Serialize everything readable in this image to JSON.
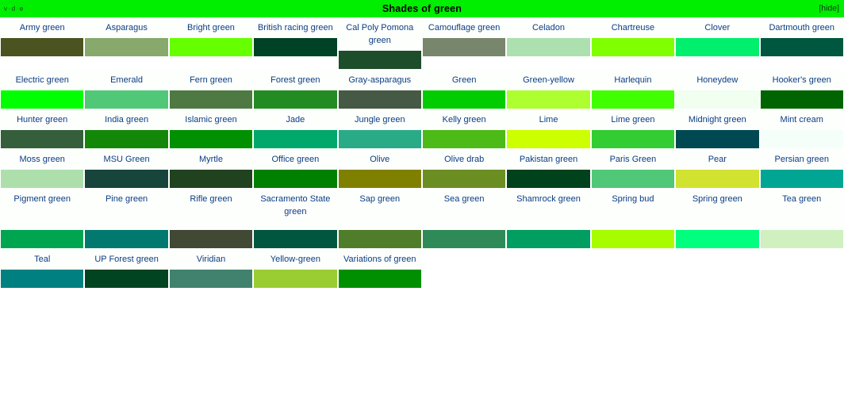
{
  "header": {
    "edit_links": [
      "v",
      "d",
      "e"
    ],
    "separator": "·",
    "title": "Shades of green",
    "hide_label": "[hide]",
    "bar_color": "#00ee00"
  },
  "link_color": "#0b3c82",
  "rows": [
    [
      {
        "name": "Army green",
        "color": "#4b5320"
      },
      {
        "name": "Asparagus",
        "color": "#87a96b"
      },
      {
        "name": "Bright green",
        "color": "#66ff00"
      },
      {
        "name": "British racing green",
        "color": "#004225"
      },
      {
        "name": "Cal Poly Pomona green",
        "color": "#1e4d2b"
      },
      {
        "name": "Camouflage green",
        "color": "#78866b"
      },
      {
        "name": "Celadon",
        "color": "#ace1af"
      },
      {
        "name": "Chartreuse",
        "color": "#7fff00"
      },
      {
        "name": "Clover",
        "color": "#00ef6c"
      },
      {
        "name": "Dartmouth green",
        "color": "#00573f"
      }
    ],
    [
      {
        "name": "Electric green",
        "color": "#00ff00"
      },
      {
        "name": "Emerald",
        "color": "#50c878"
      },
      {
        "name": "Fern green",
        "color": "#4f7942"
      },
      {
        "name": "Forest green",
        "color": "#228b22"
      },
      {
        "name": "Gray-asparagus",
        "color": "#465945"
      },
      {
        "name": "Green",
        "color": "#00cc00"
      },
      {
        "name": "Green-yellow",
        "color": "#adff2f"
      },
      {
        "name": "Harlequin",
        "color": "#3fff00"
      },
      {
        "name": "Honeydew",
        "color": "#f0fff0"
      },
      {
        "name": "Hooker's green",
        "color": "#006400"
      }
    ],
    [
      {
        "name": "Hunter green",
        "color": "#355e3b"
      },
      {
        "name": "India green",
        "color": "#138808"
      },
      {
        "name": "Islamic green",
        "color": "#009000"
      },
      {
        "name": "Jade",
        "color": "#00a86b"
      },
      {
        "name": "Jungle green",
        "color": "#29ab87"
      },
      {
        "name": "Kelly green",
        "color": "#4cbb17"
      },
      {
        "name": "Lime",
        "color": "#ccff00"
      },
      {
        "name": "Lime green",
        "color": "#32cd32"
      },
      {
        "name": "Midnight green",
        "color": "#004953"
      },
      {
        "name": "Mint cream",
        "color": "#f5fffa"
      }
    ],
    [
      {
        "name": "Moss green",
        "color": "#addfad"
      },
      {
        "name": "MSU Green",
        "color": "#18453b"
      },
      {
        "name": "Myrtle",
        "color": "#21421e"
      },
      {
        "name": "Office green",
        "color": "#008000"
      },
      {
        "name": "Olive",
        "color": "#808000"
      },
      {
        "name": "Olive drab",
        "color": "#6b8e23"
      },
      {
        "name": "Pakistan green",
        "color": "#00421b"
      },
      {
        "name": "Paris Green",
        "color": "#50c878"
      },
      {
        "name": "Pear",
        "color": "#d1e231"
      },
      {
        "name": "Persian green",
        "color": "#00a693"
      }
    ],
    [
      {
        "name": "Pigment green",
        "color": "#00a550"
      },
      {
        "name": "Pine green",
        "color": "#01796f"
      },
      {
        "name": "Rifle green",
        "color": "#414833"
      },
      {
        "name": "Sacramento State green",
        "color": "#00563f"
      },
      {
        "name": "Sap green",
        "color": "#507d2a"
      },
      {
        "name": "Sea green",
        "color": "#2e8b57"
      },
      {
        "name": "Shamrock green",
        "color": "#009e60"
      },
      {
        "name": "Spring bud",
        "color": "#a7fc00"
      },
      {
        "name": "Spring green",
        "color": "#00ff7f"
      },
      {
        "name": "Tea green",
        "color": "#d0f0c0"
      }
    ],
    [
      {
        "name": "Teal",
        "color": "#008080"
      },
      {
        "name": "UP Forest green",
        "color": "#014421"
      },
      {
        "name": "Viridian",
        "color": "#40826d"
      },
      {
        "name": "Yellow-green",
        "color": "#9acd32"
      },
      {
        "name": "Variations of green",
        "color": "#008f00"
      }
    ]
  ]
}
